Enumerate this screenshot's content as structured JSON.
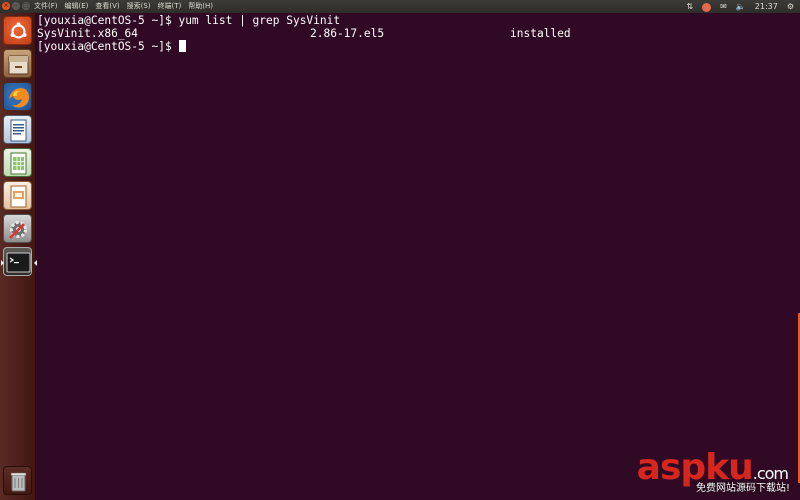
{
  "topbar": {
    "menus": [
      "文件(F)",
      "编辑(E)",
      "查看(V)",
      "搜索(S)",
      "终端(T)",
      "帮助(H)"
    ],
    "clock": "21:37"
  },
  "launcher": {
    "items": [
      {
        "name": "dash-home",
        "icon": "ubuntu-logo-icon"
      },
      {
        "name": "files",
        "icon": "file-cabinet-icon"
      },
      {
        "name": "firefox",
        "icon": "firefox-icon"
      },
      {
        "name": "libreoffice-writer",
        "icon": "writer-document-icon"
      },
      {
        "name": "libreoffice-calc",
        "icon": "calc-spreadsheet-icon"
      },
      {
        "name": "libreoffice-impress",
        "icon": "impress-presentation-icon"
      },
      {
        "name": "system-settings",
        "icon": "settings-gear-icon"
      },
      {
        "name": "terminal",
        "icon": "terminal-icon",
        "active": true
      },
      {
        "name": "trash",
        "icon": "trash-icon"
      }
    ]
  },
  "terminal": {
    "prompt1": "[youxia@CentOS-5 ~]$ ",
    "command1": "yum list | grep SysVinit",
    "result": {
      "package": "SysVinit.x86_64",
      "version": "2.86-17.el5",
      "status": "installed"
    },
    "prompt2": "[youxia@CentOS-5 ~]$ "
  },
  "watermark": {
    "brand_main": "aspku",
    "brand_tld": ".com",
    "subtitle": "免费网站源码下载站!"
  },
  "colors": {
    "terminal_bg": "#300a24",
    "accent": "#e6582a",
    "text": "#ffffff"
  }
}
